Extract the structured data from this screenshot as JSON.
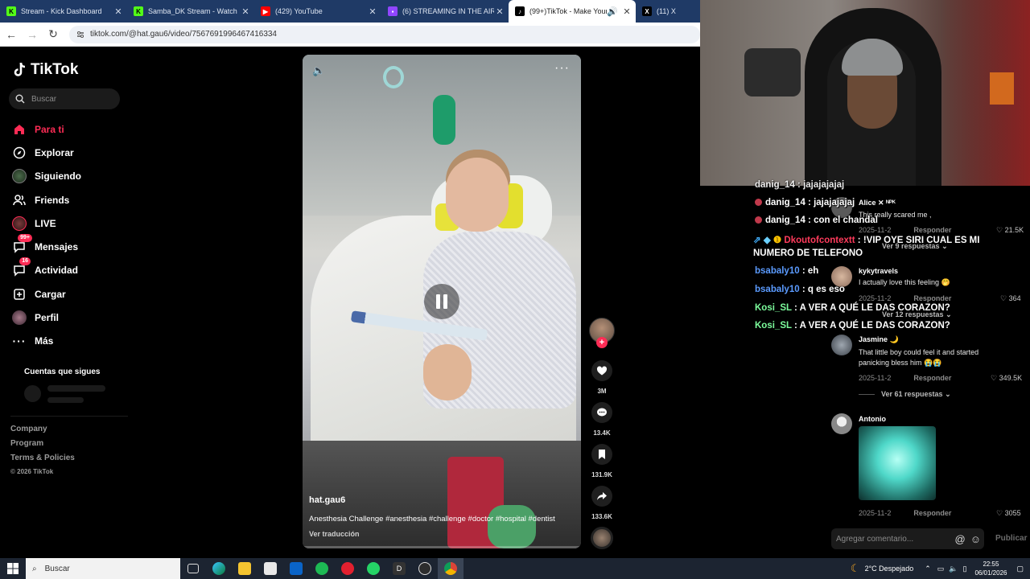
{
  "browser": {
    "tabs": [
      {
        "title": "Stream - Kick Dashboard",
        "favicon_color": "#53fc18",
        "active": false
      },
      {
        "title": "Samba_DK Stream - Watch Live",
        "favicon_color": "#53fc18",
        "active": false
      },
      {
        "title": "(429) YouTube",
        "favicon_color": "#ff0000",
        "active": false
      },
      {
        "title": "(6) STREAMING IN THE AIRPORT",
        "favicon_color": "#9146ff",
        "active": false
      },
      {
        "title": "(99+)TikTok - Make Your Day",
        "favicon_color": "#000000",
        "active": true
      },
      {
        "title": "(11) X",
        "favicon_color": "#000000",
        "active": false
      }
    ],
    "url": "tiktok.com/@hat.gau6/video/7567691996467416334"
  },
  "tiktok": {
    "brand": "TikTok",
    "search_placeholder": "Buscar",
    "nav": [
      {
        "label": "Para ti",
        "icon": "home-icon",
        "active": true
      },
      {
        "label": "Explorar",
        "icon": "compass-icon"
      },
      {
        "label": "Siguiendo",
        "icon": "following-avatar-icon"
      },
      {
        "label": "Friends",
        "icon": "friends-icon"
      },
      {
        "label": "LIVE",
        "icon": "live-icon"
      },
      {
        "label": "Mensajes",
        "icon": "messages-icon",
        "badge": "99+"
      },
      {
        "label": "Actividad",
        "icon": "activity-icon",
        "badge": "16"
      },
      {
        "label": "Cargar",
        "icon": "upload-icon"
      },
      {
        "label": "Perfil",
        "icon": "profile-avatar-icon"
      },
      {
        "label": "Más",
        "icon": "more-icon"
      }
    ],
    "following_title": "Cuentas que sigues",
    "footer": {
      "company": "Company",
      "program": "Program",
      "terms": "Terms & Policies",
      "copyright": "© 2026 TikTok"
    },
    "video": {
      "author": "hat.gau6",
      "caption": "Anesthesia Challenge #anesthesia #challenge #doctor #hospital #dentist",
      "translate": "Ver traducción",
      "progress": 0.0
    },
    "actions": {
      "likes": "3M",
      "comments": "13.4K",
      "saves": "131.9K",
      "shares": "133.6K"
    }
  },
  "chat": [
    {
      "user": "danig_14",
      "message": "jajajajajaj",
      "color": "#ffffff"
    },
    {
      "user": "danig_14",
      "message": "jajajajajaj",
      "color": "#ffffff"
    },
    {
      "user": "danig_14",
      "message": "con el chandal",
      "color": "#ffffff"
    },
    {
      "user": "Dkoutofcontextt",
      "message": "!VIP OYE SIRI CUAL ES MI",
      "message2": "NUMERO DE TELEFONO",
      "color": "#ff3b5c"
    },
    {
      "user": "bsabaly10",
      "message": "eh",
      "color": "#5b9bff"
    },
    {
      "user": "bsabaly10",
      "message": "q es eso",
      "color": "#5b9bff"
    },
    {
      "user": "Kosi_SL",
      "message": "A VER A QUÉ LE DAS CORAZON?",
      "color": "#7cfc9c"
    },
    {
      "user": "Kosi_SL",
      "message": "A VER A QUÉ LE DAS CORAZON?",
      "color": "#7cfc9c"
    }
  ],
  "comments": [
    {
      "name": "Alice ✕ ᴺᴾᴷ",
      "text": "This really scared me ,",
      "date": "2025-11-2",
      "reply": "Responder",
      "likes": "21.5K",
      "replies": "Ver 9 respuestas"
    },
    {
      "name": "kykytravels",
      "text": "I actually love this feeling 🤭",
      "date": "2025-11-2",
      "reply": "Responder",
      "likes": "364",
      "replies": "Ver 12 respuestas"
    },
    {
      "name": "Jasmine 🌙",
      "text": "That little boy could feel it and started panicking bless him 😭😭",
      "date": "2025-11-2",
      "reply": "Responder",
      "likes": "349.5K",
      "replies": "Ver 61 respuestas"
    },
    {
      "name": "Antonio",
      "text": "",
      "date": "2025-11-2",
      "reply": "Responder",
      "likes": "3055"
    }
  ],
  "comment_input": {
    "placeholder": "Agregar comentario...",
    "publish": "Publicar"
  },
  "taskbar": {
    "search": "Buscar",
    "weather": "2°C Despejado",
    "time": "22:55",
    "date": "06/01/2026"
  }
}
